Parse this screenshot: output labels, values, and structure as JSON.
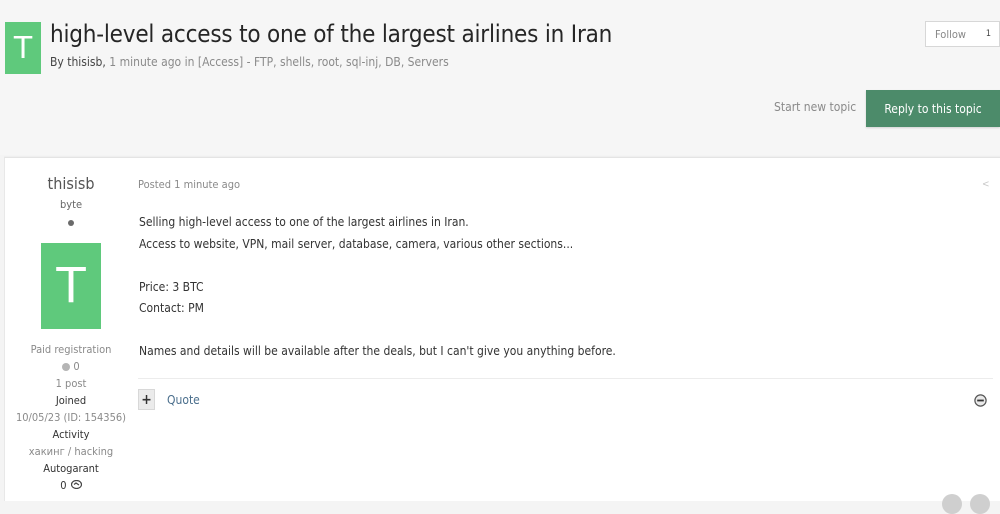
{
  "topic": {
    "avatar_letter": "T",
    "title": "high-level access to one of the largest airlines in Iran",
    "meta": {
      "prefix": "By",
      "author": "thisisb",
      "time": "1 minute ago",
      "in_word": "in",
      "forum": "[Access] - FTP, shells, root, sql-inj, DB, Servers"
    }
  },
  "actions": {
    "follow_label": "Follow",
    "follow_count": "1",
    "start_topic": "Start new topic",
    "reply": "Reply to this topic"
  },
  "author": {
    "name": "thisisb",
    "rank": "byte",
    "avatar_letter": "T",
    "group": "Paid registration",
    "reputation": "0",
    "posts": "1 post",
    "joined_label": "Joined",
    "joined_value": "10/05/23 (ID: 154356)",
    "activity_label": "Activity",
    "activity_value": "хакинг / hacking",
    "autogarant_label": "Autogarant",
    "autogarant_value": "0"
  },
  "post": {
    "date": "Posted 1 minute ago",
    "lines": [
      "Selling high-level access to one of the largest airlines in Iran.",
      "Access to website, VPN, mail server, database, camera, various other sections...",
      "",
      "Price: 3 BTC",
      "Contact: PM",
      "",
      "Names and details will be available after the deals, but I can't give you anything before."
    ],
    "plus_symbol": "+",
    "quote_label": "Quote"
  },
  "colors": {
    "avatar": "#5fc97c",
    "reply_button": "#4c8b6a",
    "link": "#4a6e8c"
  },
  "icons": {
    "share": "share-icon",
    "reaction": "reaction-icon",
    "handshake": "handshake-icon"
  }
}
